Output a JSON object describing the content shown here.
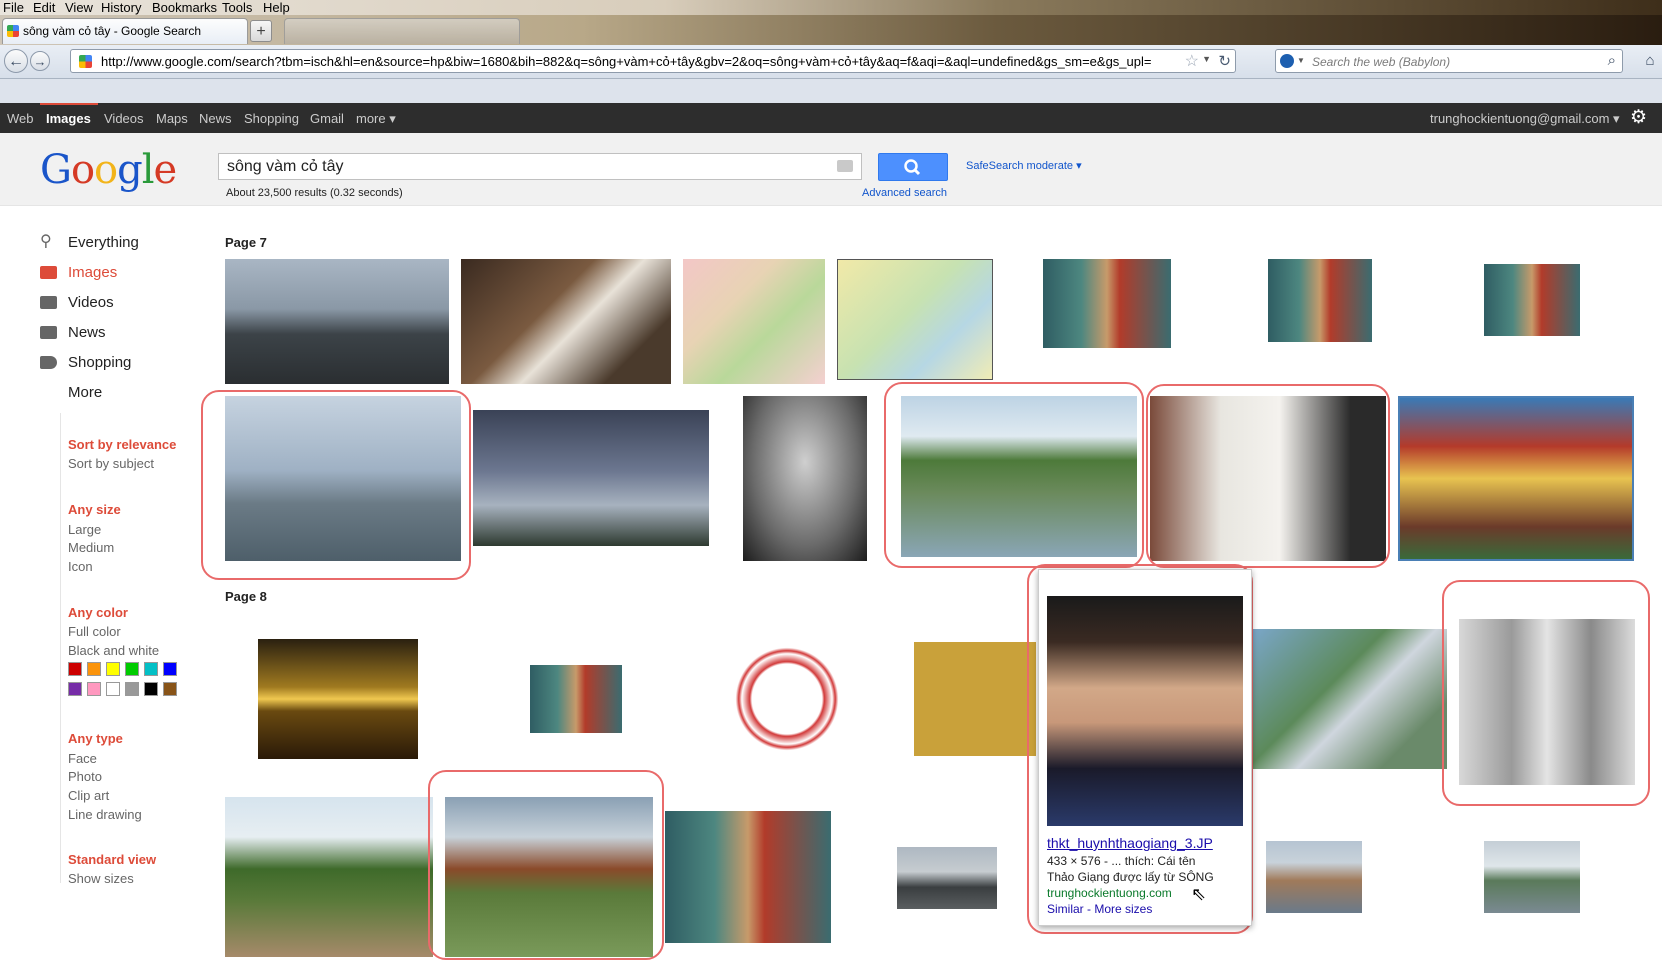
{
  "menubar": [
    "File",
    "Edit",
    "View",
    "History",
    "Bookmarks",
    "Tools",
    "Help"
  ],
  "tab": {
    "title": "sông vàm cỏ tây - Google Search",
    "new_tab": "+"
  },
  "address": {
    "url": "http://www.google.com/search?tbm=isch&hl=en&source=hp&biw=1680&bih=882&q=sông+vàm+cỏ+tây&gbv=2&oq=sông+vàm+cỏ+tây&aq=f&aqi=&aql=undefined&gs_sm=e&gs_upl="
  },
  "web_search": {
    "placeholder": "Search the web (Babylon)"
  },
  "gbar": {
    "items": [
      "Web",
      "Images",
      "Videos",
      "Maps",
      "News",
      "Shopping",
      "Gmail",
      "more ▾"
    ],
    "account": "trunghockientuong@gmail.com ▾"
  },
  "search": {
    "query": "sông vàm cỏ tây",
    "stats": "About 23,500 results (0.32 seconds)",
    "safesearch": "SafeSearch moderate ▾",
    "advanced": "Advanced search"
  },
  "logo": [
    "G",
    "o",
    "o",
    "g",
    "l",
    "e"
  ],
  "left_nav": {
    "items": [
      "Everything",
      "Images",
      "Videos",
      "News",
      "Shopping",
      "More"
    ],
    "sort": [
      "Sort by relevance",
      "Sort by subject"
    ],
    "size": [
      "Any size",
      "Large",
      "Medium",
      "Icon"
    ],
    "color": [
      "Any color",
      "Full color",
      "Black and white"
    ],
    "type": [
      "Any type",
      "Face",
      "Photo",
      "Clip art",
      "Line drawing"
    ],
    "view": [
      "Standard view",
      "Show sizes"
    ],
    "swatches": [
      "#cc0000",
      "#fb940b",
      "#ffff00",
      "#00cc00",
      "#03c0c6",
      "#0000ff",
      "#762ca7",
      "#ff98bf",
      "#ffffff",
      "#999999",
      "#000000",
      "#885418"
    ]
  },
  "results": {
    "page7": "Page 7",
    "page8": "Page 8",
    "hover": {
      "title": "thkt_huynhthaogiang_3.JP",
      "meta": "433 × 576 - ... thích: Cái tên",
      "snippet": "Thảo Giạng được lấy từ SÔNG",
      "site": "trunghockientuong.com",
      "similar": "Similar",
      "sep": " - ",
      "more_sizes": "More sizes"
    }
  },
  "colors": {
    "accent_red": "#dd4b39",
    "link_blue": "#1a0dab",
    "ring_red": "#e96a6a",
    "search_blue": "#4d90fe"
  }
}
